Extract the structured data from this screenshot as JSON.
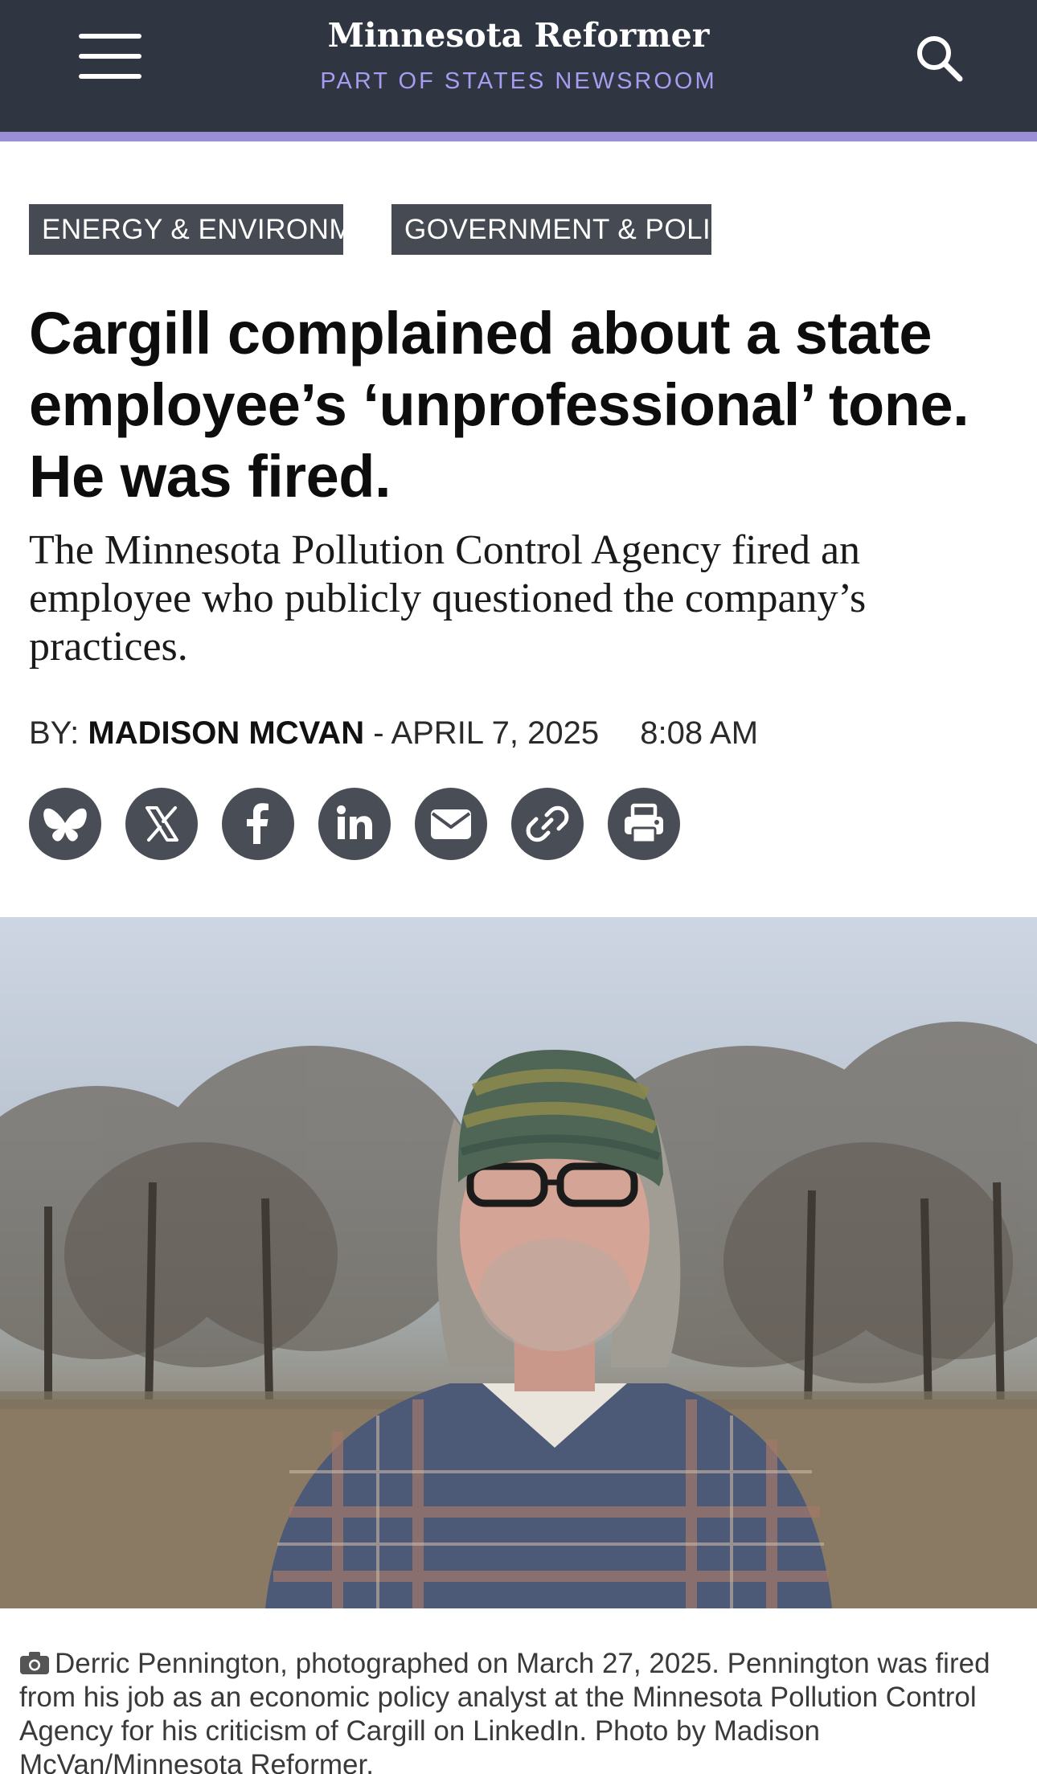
{
  "header": {
    "brand_name": "Minnesota Reformer",
    "brand_tagline": "PART OF STATES NEWSROOM",
    "menu_icon": "hamburger-menu-icon",
    "search_icon": "search-icon",
    "colors": {
      "bar": "#2f3541",
      "accent": "#9a8fd6",
      "tagline": "#a79cf0"
    }
  },
  "article": {
    "categories": [
      "ENERGY & ENVIRONMENT",
      "GOVERNMENT & POLITICS"
    ],
    "headline": "Cargill complained about a state employee’s ‘unprofessional’ tone. He was fired.",
    "dek": "The Minnesota Pollution Control Agency fired an employee who publicly questioned the company’s practices.",
    "byline": {
      "prefix": "BY:",
      "author": "MADISON MCVAN",
      "date": "- APRIL 7, 2025",
      "time": "8:08 AM"
    },
    "share_buttons": [
      {
        "icon": "bluesky-icon"
      },
      {
        "icon": "x-icon"
      },
      {
        "icon": "facebook-icon"
      },
      {
        "icon": "linkedin-icon"
      },
      {
        "icon": "email-icon"
      },
      {
        "icon": "link-icon"
      },
      {
        "icon": "print-icon"
      }
    ],
    "photo": {
      "caption": "Derric Pennington, photographed on March 27, 2025. Pennington was fired from his job as an economic policy analyst at the Minnesota Pollution Control Agency for his criticism of Cargill on LinkedIn. Photo by Madison McVan/Minnesota Reformer.",
      "caption_icon": "camera-icon"
    }
  }
}
